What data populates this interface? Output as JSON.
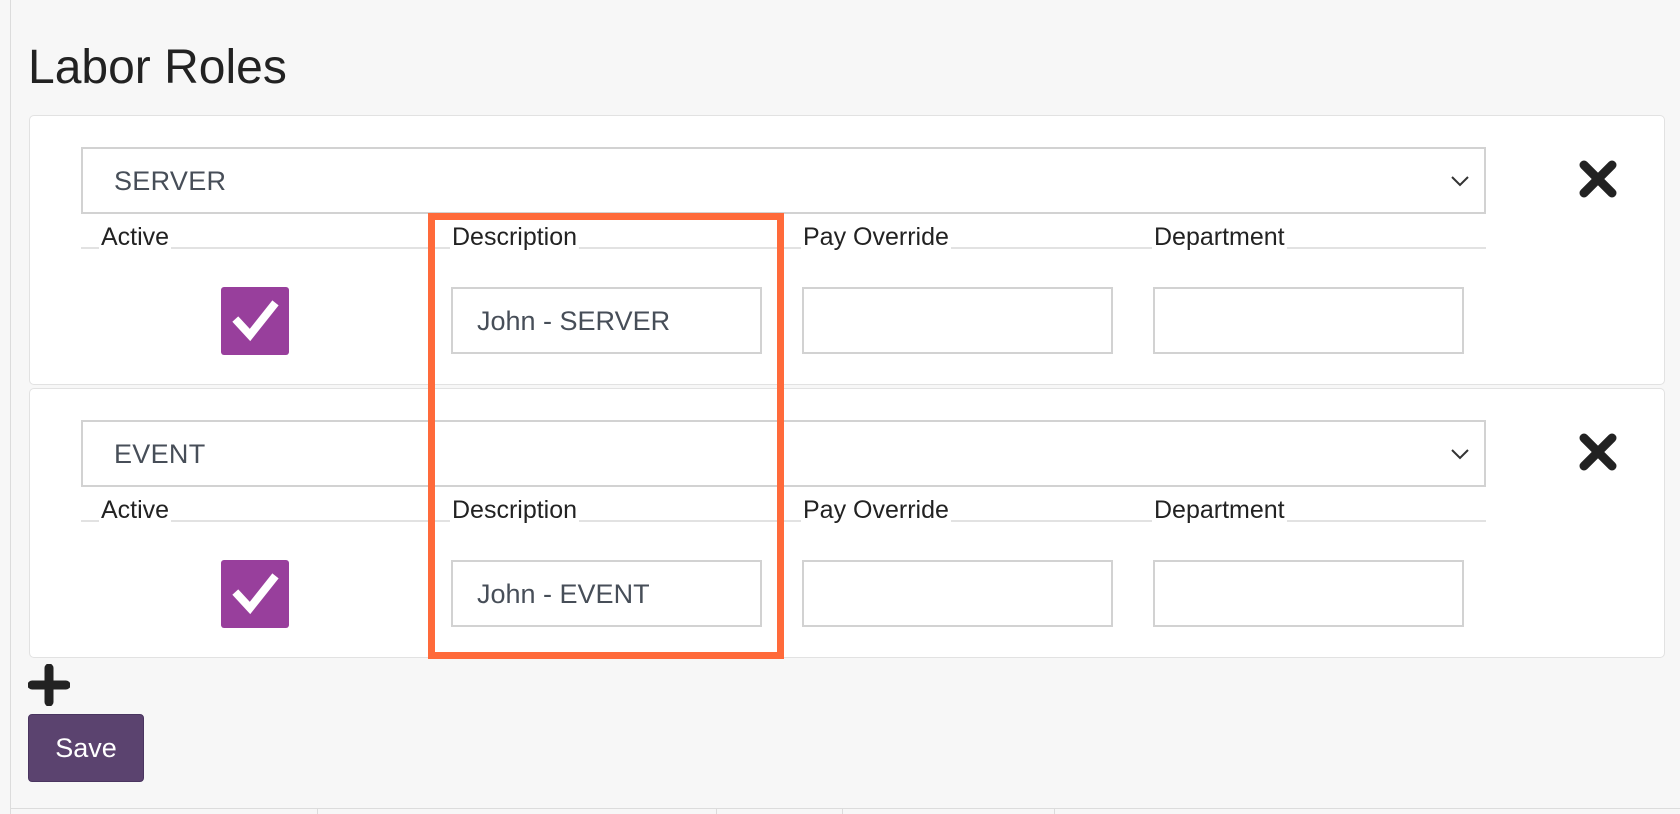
{
  "page": {
    "title": "Labor Roles"
  },
  "roles": [
    {
      "role_value": "SERVER",
      "active": true,
      "labels": {
        "active": "Active",
        "description": "Description",
        "pay_override": "Pay Override",
        "department": "Department"
      },
      "description_value": "John - SERVER",
      "pay_override_value": "",
      "department_value": ""
    },
    {
      "role_value": "EVENT",
      "active": true,
      "labels": {
        "active": "Active",
        "description": "Description",
        "pay_override": "Pay Override",
        "department": "Department"
      },
      "description_value": "John - EVENT",
      "pay_override_value": "",
      "department_value": ""
    }
  ],
  "actions": {
    "save_label": "Save"
  },
  "icons": {
    "remove": "close-icon",
    "add": "plus-icon",
    "checkbox": "checkmark-icon",
    "select": "chevron-down-icon"
  },
  "colors": {
    "checkbox_fill": "#983f9c",
    "save_button": "#5b436f",
    "highlight": "#ff6a3a",
    "background": "#f7f7f7"
  }
}
